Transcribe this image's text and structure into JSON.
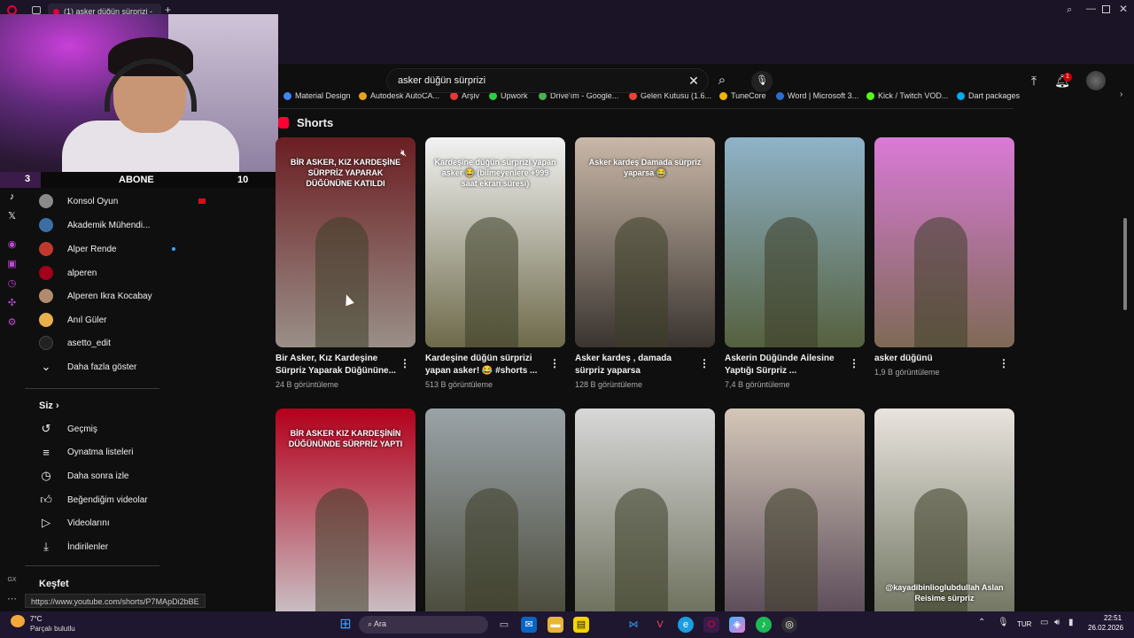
{
  "browser": {
    "tab_title": "(1) asker düğün sürprizi -",
    "bookmarks": [
      "Material Design",
      "Autodesk AutoCA...",
      "Arşiv",
      "Upwork",
      "Drive'ım - Google...",
      "Gelen Kutusu (1.6...",
      "TuneCore",
      "Word | Microsoft 3...",
      "Kick / Twitch VOD...",
      "Dart packages"
    ],
    "bookmark_colors": [
      "#4285f4",
      "#e8a11a",
      "#e53935",
      "#2ecc40",
      "#4caf50",
      "#ea4335",
      "#f0b400",
      "#2b6cd4",
      "#53fc18",
      "#03a9f4"
    ]
  },
  "webcam": {
    "left_num": "3",
    "abone": "ABONE",
    "right_num": "10"
  },
  "sidebar": {
    "subscriptions": [
      {
        "label": "Konsol Oyun",
        "color": "#8a8a8a"
      },
      {
        "label": "Akademik Mühendi...",
        "color": "#3b6ea5"
      },
      {
        "label": "Alper Rende",
        "color": "#c0392b"
      },
      {
        "label": "alperen",
        "color": "#a3001b"
      },
      {
        "label": "Alperen Ikra Kocabay",
        "color": "#b08b6e"
      },
      {
        "label": "Anıl Güler",
        "color": "#e8b04a"
      },
      {
        "label": "asetto_edit",
        "color": "#222222"
      }
    ],
    "show_more": "Daha fazla göster",
    "you_heading": "Siz",
    "you_items": [
      {
        "label": "Geçmiş",
        "icon": "history-icon"
      },
      {
        "label": "Oynatma listeleri",
        "icon": "playlist-icon"
      },
      {
        "label": "Daha sonra izle",
        "icon": "watch-later-icon"
      },
      {
        "label": "Beğendiğim videolar",
        "icon": "like-icon"
      },
      {
        "label": "Videolarını",
        "icon": "your-videos-icon"
      },
      {
        "label": "İndirilenler",
        "icon": "download-icon"
      }
    ],
    "explore_heading": "Keşfet"
  },
  "header": {
    "search_value": "asker düğün sürprizi",
    "notification_count": "1"
  },
  "shorts": {
    "section_title": "Shorts",
    "row1": [
      {
        "title": "Bir Asker, Kız Kardeşine Sürpriz Yaparak Düğününe...",
        "views": "24 B görüntüleme",
        "overlay": "BİR ASKER, KIZ KARDEŞİNE SÜRPRİZ YAPARAK DÜĞÜNÜNE KATILDI",
        "bg1": "#6b1e22",
        "bg2": "#9a8f88"
      },
      {
        "title": "Kardeşine düğün sürprizi yapan asker! 😂 #shorts ...",
        "views": "513 B görüntüleme",
        "overlay": "Kardeşine düğün sürprizi yapan asker 😂 (bilmeyenlere +999 saat ekran süresi)",
        "bg1": "#f2f2f2",
        "bg2": "#6d6a4a"
      },
      {
        "title": "Asker kardeş , damada sürpriz yaparsa",
        "views": "128 B görüntüleme",
        "overlay": "Asker kardeş Damada sürpriz yaparsa 😂",
        "bg1": "#c9b8a8",
        "bg2": "#3a3430"
      },
      {
        "title": "Askerin Düğünde Ailesine Yaptığı Sürpriz ...",
        "views": "7,4 B görüntüleme",
        "overlay": "",
        "bg1": "#8fb3c9",
        "bg2": "#55603e"
      },
      {
        "title": "asker düğünü",
        "views": "1,9 B görüntüleme",
        "overlay": "",
        "bg1": "#d97ad6",
        "bg2": "#7e6a55"
      }
    ],
    "row2": [
      {
        "overlay": "BİR ASKER KIZ KARDEŞİNİN DÜĞÜNÜNDE SÜRPRİZ YAPTI",
        "bg1": "#b3001b",
        "bg2": "#c9c4c8"
      },
      {
        "overlay": "",
        "bg1": "#9aa3a8",
        "bg2": "#4a4a3a"
      },
      {
        "overlay": "",
        "bg1": "#d8d8d8",
        "bg2": "#6b6f5a"
      },
      {
        "overlay": "",
        "bg1": "#d4c7b8",
        "bg2": "#5a4a58"
      },
      {
        "overlay": "@kayadibinlioglubdullah Aslan Reisime sürpriz",
        "bg1": "#e9e4de",
        "bg2": "#6f7460"
      }
    ]
  },
  "status_url": "https://www.youtube.com/shorts/P7MApDi2bBE",
  "taskbar": {
    "weather_temp": "7°C",
    "weather_desc": "Parçalı bulutlu",
    "search_label": "Ara",
    "lang": "TUR",
    "time": "22:51",
    "date": "26.02.2026"
  }
}
